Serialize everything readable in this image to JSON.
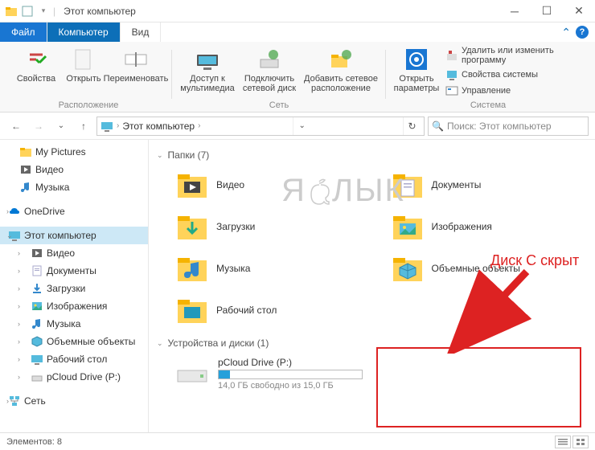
{
  "window": {
    "title": "Этот компьютер"
  },
  "tabs": {
    "file": "Файл",
    "computer": "Компьютер",
    "view": "Вид"
  },
  "ribbon": {
    "location": {
      "properties": "Свойства",
      "open": "Открыть",
      "rename": "Переименовать",
      "group": "Расположение"
    },
    "network": {
      "media": "Доступ к мультимедиа",
      "map": "Подключить сетевой диск",
      "add": "Добавить сетевое расположение",
      "group": "Сеть"
    },
    "system": {
      "params": "Открыть параметры",
      "uninstall": "Удалить или изменить программу",
      "sysprops": "Свойства системы",
      "manage": "Управление",
      "group": "Система"
    }
  },
  "nav": {
    "path": "Этот компьютер",
    "search_placeholder": "Поиск: Этот компьютер"
  },
  "sidebar": {
    "items": [
      {
        "label": "My Pictures",
        "kind": "folder"
      },
      {
        "label": "Видео",
        "kind": "video"
      },
      {
        "label": "Музыка",
        "kind": "music"
      },
      {
        "label": "OneDrive",
        "kind": "onedrive",
        "root": true
      },
      {
        "label": "Этот компьютер",
        "kind": "pc",
        "root": true,
        "selected": true,
        "exp": true
      },
      {
        "label": "Видео",
        "kind": "video",
        "sub": true
      },
      {
        "label": "Документы",
        "kind": "docs",
        "sub": true
      },
      {
        "label": "Загрузки",
        "kind": "downloads",
        "sub": true
      },
      {
        "label": "Изображения",
        "kind": "pictures",
        "sub": true
      },
      {
        "label": "Музыка",
        "kind": "music",
        "sub": true
      },
      {
        "label": "Объемные объекты",
        "kind": "3d",
        "sub": true
      },
      {
        "label": "Рабочий стол",
        "kind": "desktop",
        "sub": true
      },
      {
        "label": "pCloud Drive (P:)",
        "kind": "drive",
        "sub": true
      },
      {
        "label": "Сеть",
        "kind": "network",
        "root": true
      }
    ]
  },
  "content": {
    "folders_header": "Папки (7)",
    "folders": [
      {
        "label": "Видео"
      },
      {
        "label": "Документы"
      },
      {
        "label": "Загрузки"
      },
      {
        "label": "Изображения"
      },
      {
        "label": "Музыка"
      },
      {
        "label": "Объемные объекты"
      },
      {
        "label": "Рабочий стол"
      }
    ],
    "drives_header": "Устройства и диски (1)",
    "drive": {
      "name": "pCloud Drive (P:)",
      "free_text": "14,0 ГБ свободно из 15,0 ГБ",
      "fill_pct": 8
    }
  },
  "annotation": {
    "text": "Диск С скрыт"
  },
  "status": {
    "count": "Элементов: 8"
  },
  "watermark": "ЯБЛЫК"
}
